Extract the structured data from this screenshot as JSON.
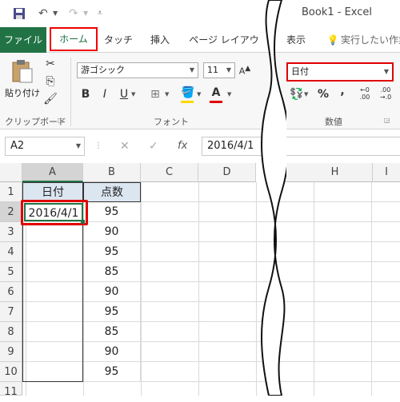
{
  "title": "Book1 - Excel",
  "tabs": [
    "ファイル",
    "ホーム",
    "タッチ",
    "挿入",
    "ページ レイアウト",
    "表示",
    "実行したい作業"
  ],
  "clipboard": {
    "paste_label": "貼り付け",
    "group_label": "クリップボード"
  },
  "font": {
    "name": "游ゴシック",
    "size": "11",
    "group_label": "フォント",
    "bold": "B",
    "italic": "I",
    "underline": "U",
    "font_color_glyph": "A"
  },
  "number": {
    "format": "日付",
    "group_label": "数値",
    "percent": "%",
    "comma": ","
  },
  "formula_bar": {
    "name_box": "A2",
    "fx": "fx",
    "content": "2016/4/1"
  },
  "columns": [
    "A",
    "B",
    "C",
    "D",
    "H",
    "I"
  ],
  "rows": [
    "1",
    "2",
    "3",
    "4",
    "5",
    "6",
    "7",
    "8",
    "9",
    "10",
    "11"
  ],
  "sheet": {
    "header_a": "日付",
    "header_b": "点数",
    "a2": "2016/4/1",
    "b_values": [
      "95",
      "90",
      "95",
      "85",
      "90",
      "95",
      "85",
      "90",
      "95"
    ]
  },
  "colors": {
    "excel_green": "#217346",
    "highlight_red": "#e00000",
    "header_fill": "#dce6f1"
  }
}
